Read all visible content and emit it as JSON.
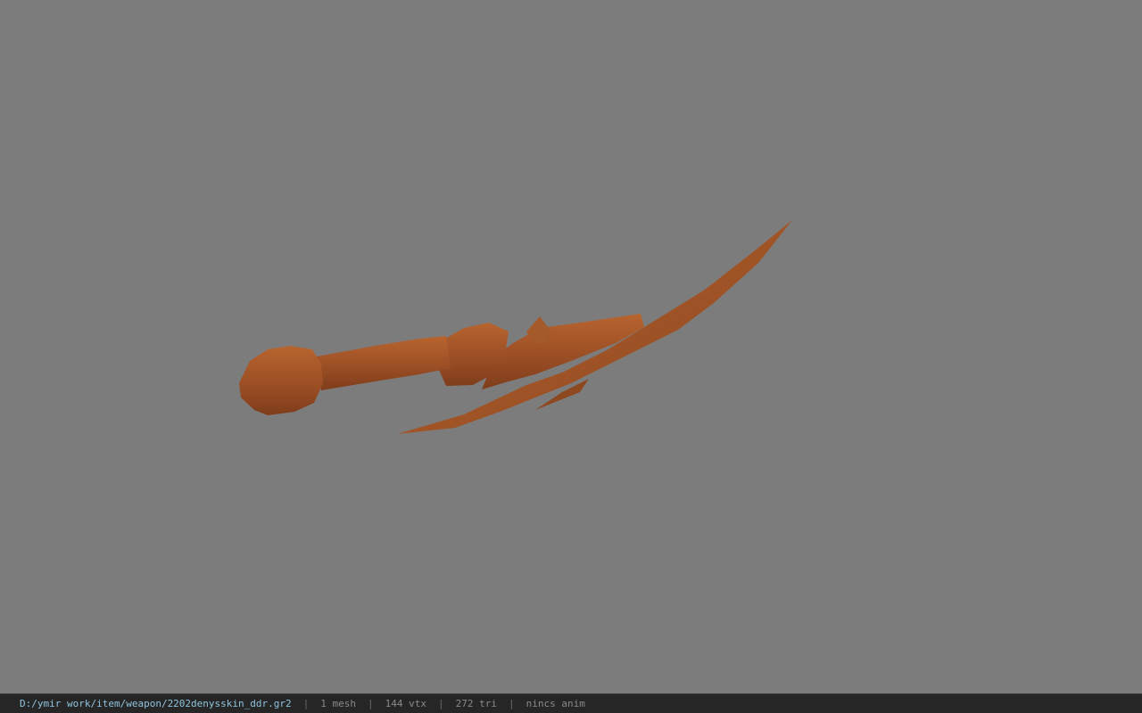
{
  "viewer": {
    "background_color": "#7c7c7c",
    "model_color": "#a5542a"
  },
  "statusbar": {
    "file_path": "D:/ymir work/item/weapon/2202denysskin_ddr.gr2",
    "separator": "|",
    "mesh_count": "1 mesh",
    "vertex_count": "144 vtx",
    "triangle_count": "272 tri",
    "anim_status": "nincs anim"
  }
}
